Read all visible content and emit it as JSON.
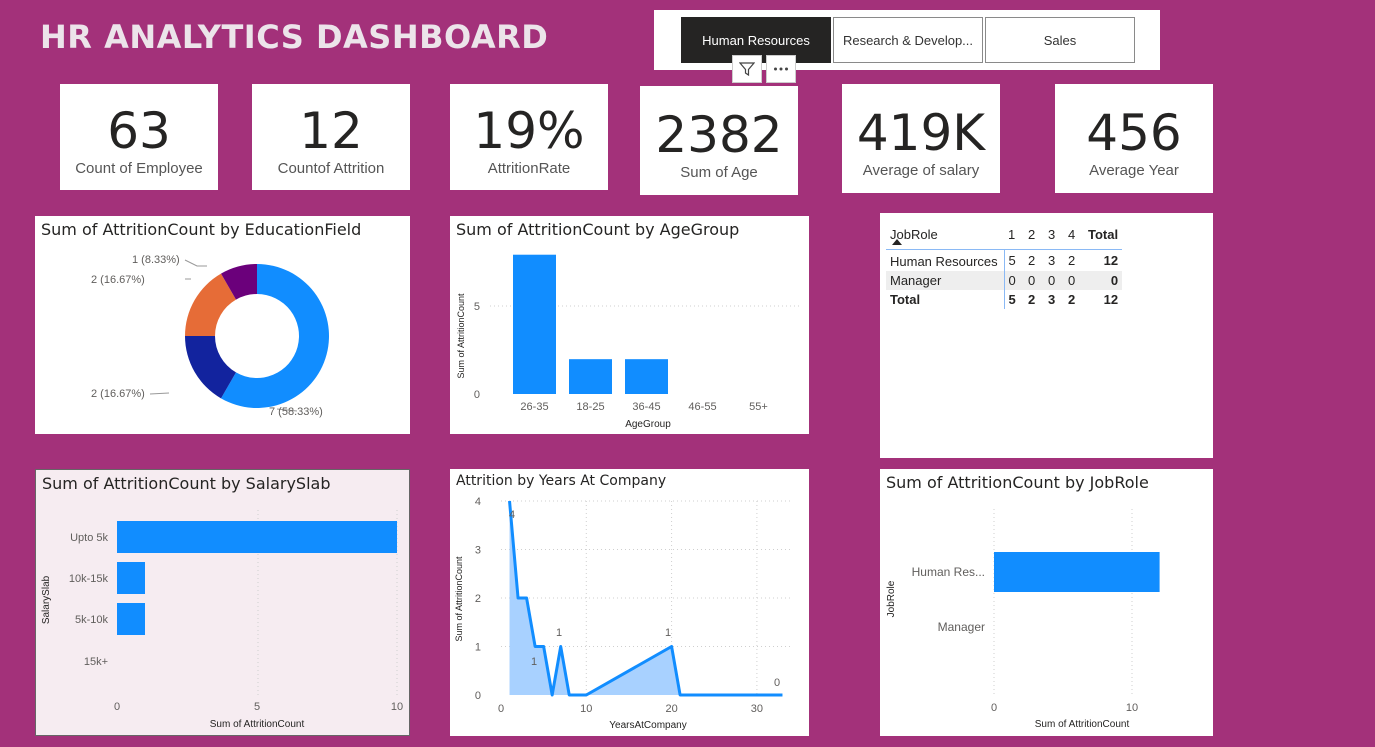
{
  "dashboard": {
    "title": "HR ANALYTICS DASHBOARD"
  },
  "slicer": {
    "options": [
      "Human Resources",
      "Research & Develop...",
      "Sales"
    ],
    "selected": "Human Resources",
    "icons": [
      "filter-icon",
      "more-options-icon"
    ]
  },
  "kpis": [
    {
      "value": "63",
      "label": "Count of Employee"
    },
    {
      "value": "12",
      "label": "Countof Attrition"
    },
    {
      "value": "19%",
      "label": "AttritionRate"
    },
    {
      "value": "2382",
      "label": "Sum of Age"
    },
    {
      "value": "419K",
      "label": "Average of salary"
    },
    {
      "value": "456",
      "label": "Average Year"
    }
  ],
  "colors": {
    "background": "#a3317a",
    "bar": "#118dff",
    "navy": "#12239e",
    "orange": "#e66c37",
    "purple": "#6b007b"
  },
  "matrix": {
    "headers": [
      "JobRole",
      "1",
      "2",
      "3",
      "4",
      "Total"
    ],
    "rows": [
      [
        "Human Resources",
        "5",
        "2",
        "3",
        "2",
        "12"
      ],
      [
        "Manager",
        "0",
        "0",
        "0",
        "0",
        "0"
      ],
      [
        "Total",
        "5",
        "2",
        "3",
        "2",
        "12"
      ]
    ]
  },
  "chart_data": [
    {
      "type": "pie",
      "title": "Sum of AttritionCount by EducationField",
      "values": [
        7,
        2,
        2,
        1
      ],
      "labels": [
        "7 (58.33%)",
        "2 (16.67%)",
        "2 (16.67%)",
        "1 (8.33%)"
      ],
      "colors": [
        "#118dff",
        "#12239e",
        "#e66c37",
        "#6b007b"
      ],
      "donut": true
    },
    {
      "type": "bar",
      "title": "Sum of AttritionCount by AgeGroup",
      "categories": [
        "26-35",
        "18-25",
        "36-45",
        "46-55",
        "55+"
      ],
      "values": [
        8,
        2,
        2,
        0,
        0
      ],
      "xlabel": "AgeGroup",
      "ylabel": "Sum of AttritionCount",
      "yticks": [
        "0",
        "5"
      ],
      "ylim": [
        0,
        8.5
      ]
    },
    {
      "type": "bar",
      "orientation": "horizontal",
      "title": "Sum of AttritionCount by SalarySlab",
      "categories": [
        "Upto 5k",
        "10k-15k",
        "5k-10k",
        "15k+"
      ],
      "values": [
        10,
        1,
        1,
        0
      ],
      "xlabel": "Sum of AttritionCount",
      "ylabel": "SalarySlab",
      "xticks": [
        "0",
        "5",
        "10"
      ],
      "xlim": [
        0,
        10
      ]
    },
    {
      "type": "area",
      "title": "Attrition by Years At Company",
      "x": [
        1,
        2,
        3,
        4,
        5,
        6,
        7,
        8,
        10,
        20,
        21,
        33
      ],
      "y": [
        4,
        2,
        2,
        1,
        1,
        0,
        1,
        0,
        0,
        1,
        0,
        0
      ],
      "data_labels": [
        "4",
        "1",
        "1",
        "1",
        "0"
      ],
      "xlabel": "YearsAtCompany",
      "ylabel": "Sum of AttritionCount",
      "xticks": [
        "0",
        "10",
        "20",
        "30"
      ],
      "yticks": [
        "0",
        "1",
        "2",
        "3",
        "4"
      ],
      "xlim": [
        0,
        34
      ],
      "ylim": [
        0,
        4
      ]
    },
    {
      "type": "bar",
      "orientation": "horizontal",
      "title": "Sum of AttritionCount by JobRole",
      "categories": [
        "Human Res...",
        "Manager"
      ],
      "values": [
        12,
        0
      ],
      "xlabel": "Sum of AttritionCount",
      "ylabel": "JobRole",
      "xticks": [
        "0",
        "10"
      ],
      "xlim": [
        0,
        12.5
      ]
    }
  ]
}
